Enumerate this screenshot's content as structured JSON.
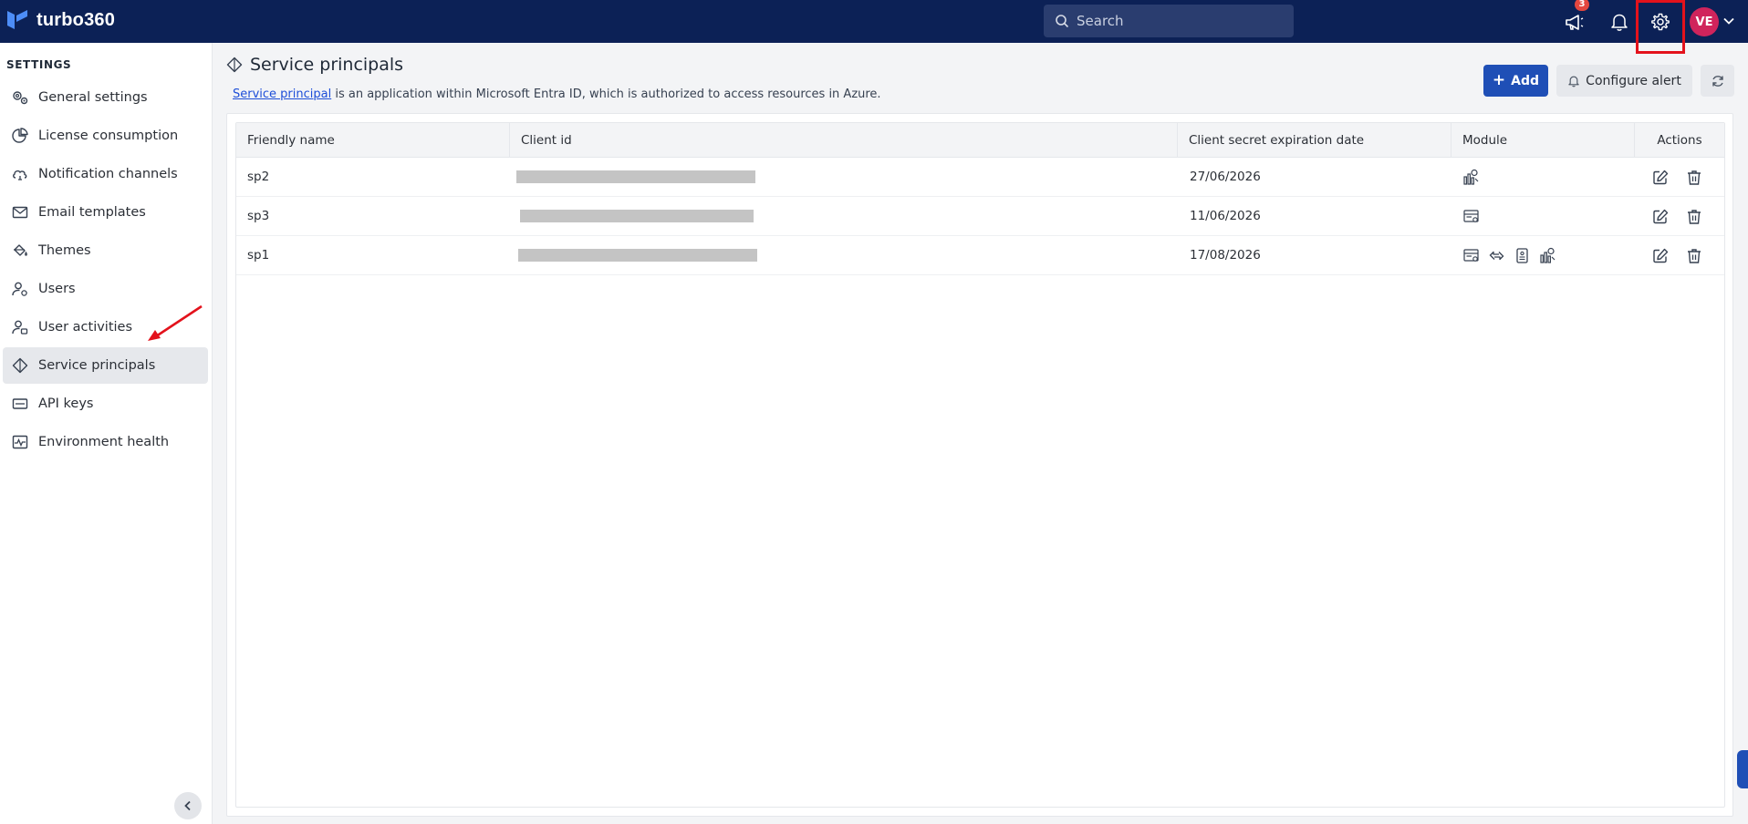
{
  "app": {
    "logo_text": "turbo360"
  },
  "topbar": {
    "search_placeholder": "Search",
    "announcement_badge": "3",
    "avatar_initials": "VE"
  },
  "sidebar": {
    "heading": "SETTINGS",
    "items": [
      {
        "label": "General settings",
        "icon": "gears-icon"
      },
      {
        "label": "License consumption",
        "icon": "pie-chart-icon"
      },
      {
        "label": "Notification channels",
        "icon": "cloud-bell-icon"
      },
      {
        "label": "Email templates",
        "icon": "envelope-icon"
      },
      {
        "label": "Themes",
        "icon": "paint-bucket-icon"
      },
      {
        "label": "Users",
        "icon": "user-gear-icon"
      },
      {
        "label": "User activities",
        "icon": "user-activity-icon"
      },
      {
        "label": "Service principals",
        "icon": "diamond-icon",
        "active": true
      },
      {
        "label": "API keys",
        "icon": "api-key-icon"
      },
      {
        "label": "Environment health",
        "icon": "pulse-icon"
      }
    ]
  },
  "page": {
    "title": "Service principals",
    "description_link": "Service principal",
    "description_rest": " is an application within Microsoft Entra ID, which is authorized to access resources in Azure.",
    "add_label": "Add",
    "configure_alert_label": "Configure alert"
  },
  "table": {
    "columns": [
      "Friendly name",
      "Client id",
      "Client secret expiration date",
      "Module",
      "Actions"
    ],
    "rows": [
      {
        "friendly_name": "sp2",
        "client_id": "",
        "expiration": "27/06/2026",
        "modules": [
          "cost-analyzer-icon"
        ]
      },
      {
        "friendly_name": "sp3",
        "client_id": "",
        "expiration": "11/06/2026",
        "modules": [
          "business-app-icon"
        ]
      },
      {
        "friendly_name": "sp1",
        "client_id": "",
        "expiration": "17/08/2026",
        "modules": [
          "business-app-icon",
          "transfer-icon",
          "document-icon",
          "cost-analyzer-icon"
        ]
      }
    ]
  },
  "colors": {
    "topbar": "#0c2156",
    "accent": "#1f4fb6",
    "highlight": "#e3121c",
    "avatar": "#d0245c"
  }
}
